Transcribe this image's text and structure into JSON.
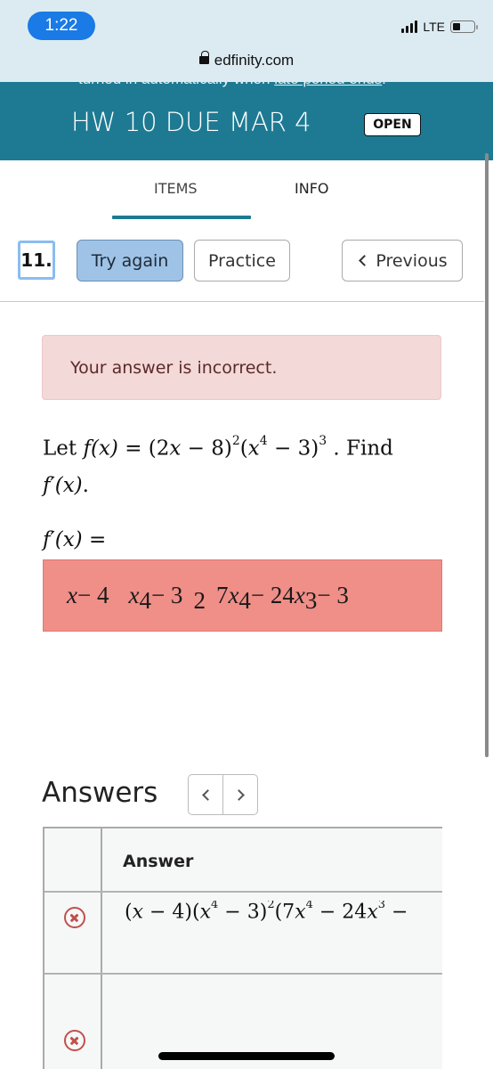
{
  "status_bar": {
    "time": "1:22",
    "network": "LTE",
    "battery_level": 0.35
  },
  "browser": {
    "url": "edfinity.com"
  },
  "header": {
    "cut_text_prefix": "turned in automatically when ",
    "cut_text_link": "late period ends",
    "cut_text_suffix": ".",
    "title": "HW 10 DUE MAR 4",
    "status_badge": "OPEN"
  },
  "tabs": {
    "items": [
      "ITEMS",
      "INFO"
    ],
    "active": "ITEMS"
  },
  "actions": {
    "item_number": "11.",
    "try_again": "Try again",
    "practice": "Practice",
    "previous": "Previous"
  },
  "alert": {
    "message": "Your answer is incorrect."
  },
  "question": {
    "prefix": "Let ",
    "fx": "f(x)",
    "equals": " = (2",
    "x": "x",
    "part1": " − 8)",
    "exp1": "2",
    "part2a": "(",
    "x2": "x",
    "exp_x4": "4",
    "part2b": " − 3)",
    "exp2": "3",
    "suffix": " . Find",
    "line2_fprime": "f′(x)",
    "line2_suffix": ".",
    "answer_prompt_f": "f′(x)",
    "answer_prompt_eq": " ="
  },
  "student_answer": {
    "status": "incorrect",
    "segments": [
      "x",
      " − 4",
      "x",
      "4",
      " − 3",
      "2",
      "7",
      "x",
      "4",
      " − 24",
      "x",
      "3",
      " − 3"
    ]
  },
  "answers": {
    "title": "Answers",
    "column_header": "Answer",
    "rows": [
      {
        "status": "incorrect",
        "expr": {
          "a": "(",
          "x1": "x",
          "b": " − 4)(",
          "x2": "x",
          "e1": "4",
          "c": " − 3)",
          "e2": "2",
          "d": "(7",
          "x3": "x",
          "e3": "4",
          "e": " − 24",
          "x4": "x",
          "e4": "3",
          "f": " −"
        }
      },
      {
        "status": "incorrect",
        "expr": null
      }
    ]
  },
  "colors": {
    "header_teal": "#1e7a92",
    "alert_bg": "#f3d9d8",
    "incorrect_input_bg": "#f08e88",
    "try_again_bg": "#9fc3e6",
    "incorrect_icon": "#c0504d",
    "time_pill": "#1a7ae6"
  }
}
